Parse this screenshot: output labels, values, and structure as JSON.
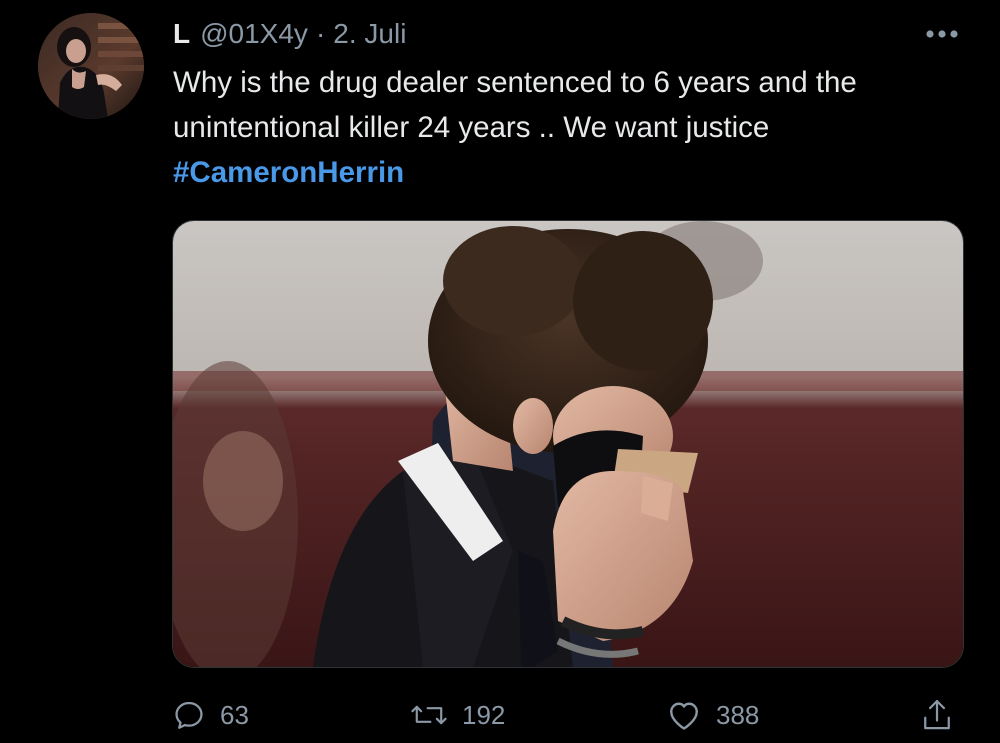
{
  "tweet": {
    "author": {
      "display_name": "L",
      "handle": "@01X4y",
      "avatar_icon": "profile-photo"
    },
    "separator": "·",
    "date": "2. Juli",
    "text_lines": [
      "Why is the drug dealer sentenced to 6 years and the",
      "unintentional killer 24 years .. We want justice"
    ],
    "hashtag": "#CameronHerrin",
    "more_icon": "more-horizontal-icon",
    "media_icon": "photo-courtroom",
    "actions": {
      "reply": {
        "icon": "reply-icon",
        "count": "63"
      },
      "retweet": {
        "icon": "retweet-icon",
        "count": "192"
      },
      "like": {
        "icon": "heart-icon",
        "count": "388"
      },
      "share": {
        "icon": "share-icon"
      }
    }
  },
  "colors": {
    "background": "#000000",
    "text": "#e7e9ea",
    "secondary": "#8b98a5",
    "hashtag": "#4a99e9"
  }
}
